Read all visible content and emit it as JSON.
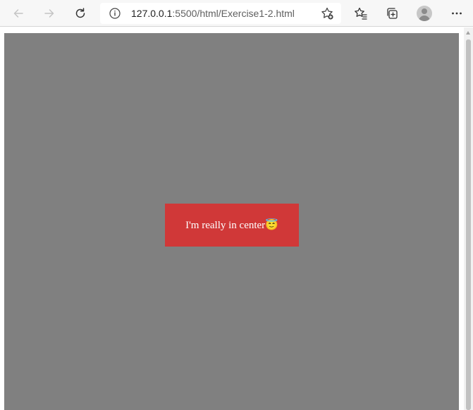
{
  "browser": {
    "address_bar": {
      "url_host": "127.0.0.1",
      "url_rest": ":5500/html/Exercise1-2.html"
    },
    "toolbar": {
      "back_icon": "back-arrow-icon",
      "forward_icon": "forward-arrow-icon",
      "refresh_icon": "refresh-icon",
      "info_icon": "info-icon",
      "add_favorite_icon": "star-plus-icon",
      "favorites_icon": "favorites-list-icon",
      "collections_icon": "collections-icon",
      "profile_icon": "avatar",
      "menu_icon": "more-horizontal-icon"
    }
  },
  "page": {
    "background_color": "#808080",
    "box": {
      "text": "I'm really in center",
      "emoji": "😇",
      "background_color": "#d03838",
      "text_color": "#ffffff"
    }
  }
}
